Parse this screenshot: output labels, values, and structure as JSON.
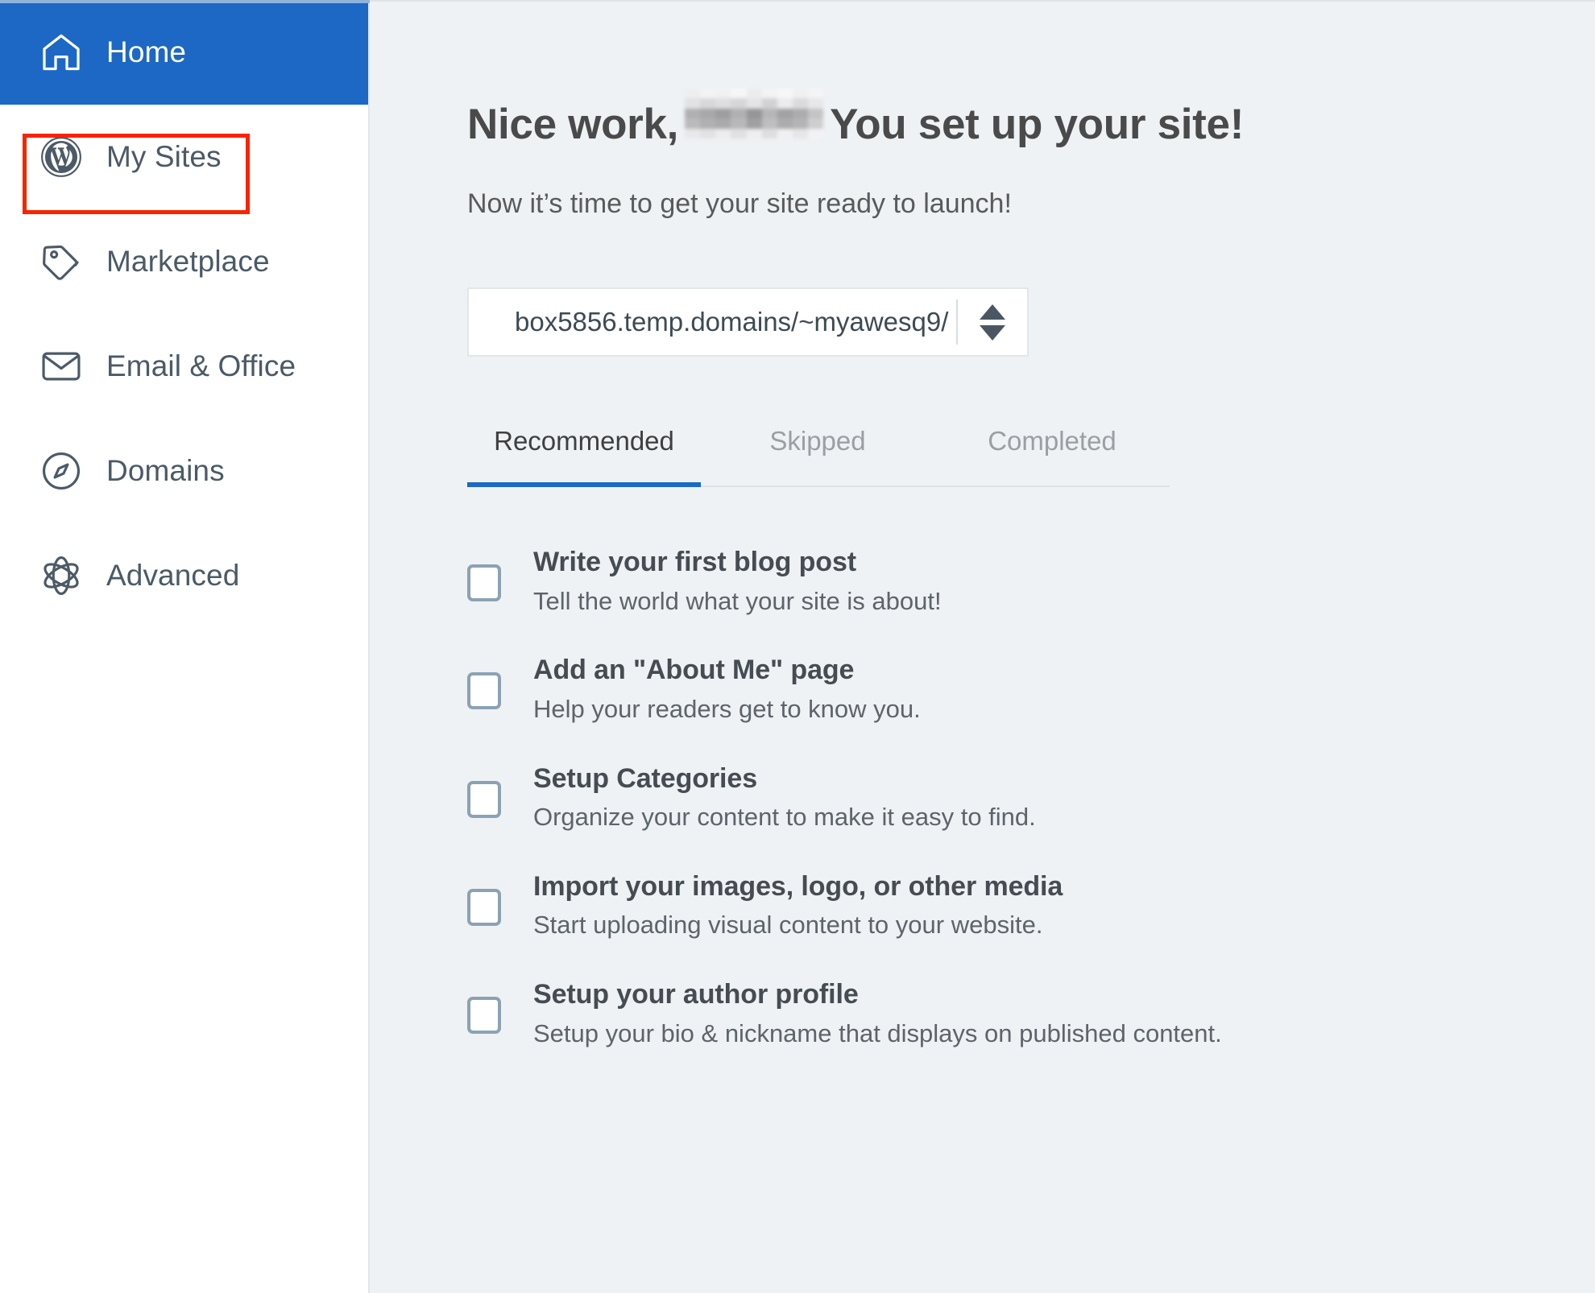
{
  "colors": {
    "accent_blue": "#1c68c4",
    "highlight_red": "#f92300",
    "main_background": "#eef2f5",
    "sidebar_background": "#ffffff",
    "checkbox_border": "#8ba2b3",
    "text_dark": "#454c52",
    "text_muted": "#9b9fa3"
  },
  "sidebar": {
    "items": [
      {
        "label": "Home",
        "icon": "home-icon",
        "active": true
      },
      {
        "label": "My Sites",
        "icon": "wordpress-icon",
        "active": false
      },
      {
        "label": "Marketplace",
        "icon": "tag-icon",
        "active": false
      },
      {
        "label": "Email & Office",
        "icon": "envelope-icon",
        "active": false
      },
      {
        "label": "Domains",
        "icon": "compass-icon",
        "active": false
      },
      {
        "label": "Advanced",
        "icon": "atom-icon",
        "active": false
      }
    ]
  },
  "main": {
    "heading_prefix": "Nice work,",
    "heading_suffix": "You set up your site!",
    "heading_redacted": "",
    "subheading": "Now it’s time to get your site ready to launch!",
    "domain_select": {
      "value": "box5856.temp.domains/~myawesq9/",
      "spinner_up_icon": "caret-up-icon",
      "spinner_down_icon": "caret-down-icon"
    },
    "tabs": [
      {
        "label": "Recommended",
        "active": true
      },
      {
        "label": "Skipped",
        "active": false
      },
      {
        "label": "Completed",
        "active": false
      }
    ],
    "tasks": [
      {
        "title": "Write your first blog post",
        "description": "Tell the world what your site is about!",
        "checked": false
      },
      {
        "title": "Add an \"About Me\" page",
        "description": "Help your readers get to know you.",
        "checked": false
      },
      {
        "title": "Setup Categories",
        "description": "Organize your content to make it easy to find.",
        "checked": false
      },
      {
        "title": "Import your images, logo, or other media",
        "description": "Start uploading visual content to your website.",
        "checked": false
      },
      {
        "title": "Setup your author profile",
        "description": "Setup your bio & nickname that displays on published content.",
        "checked": false
      }
    ]
  }
}
